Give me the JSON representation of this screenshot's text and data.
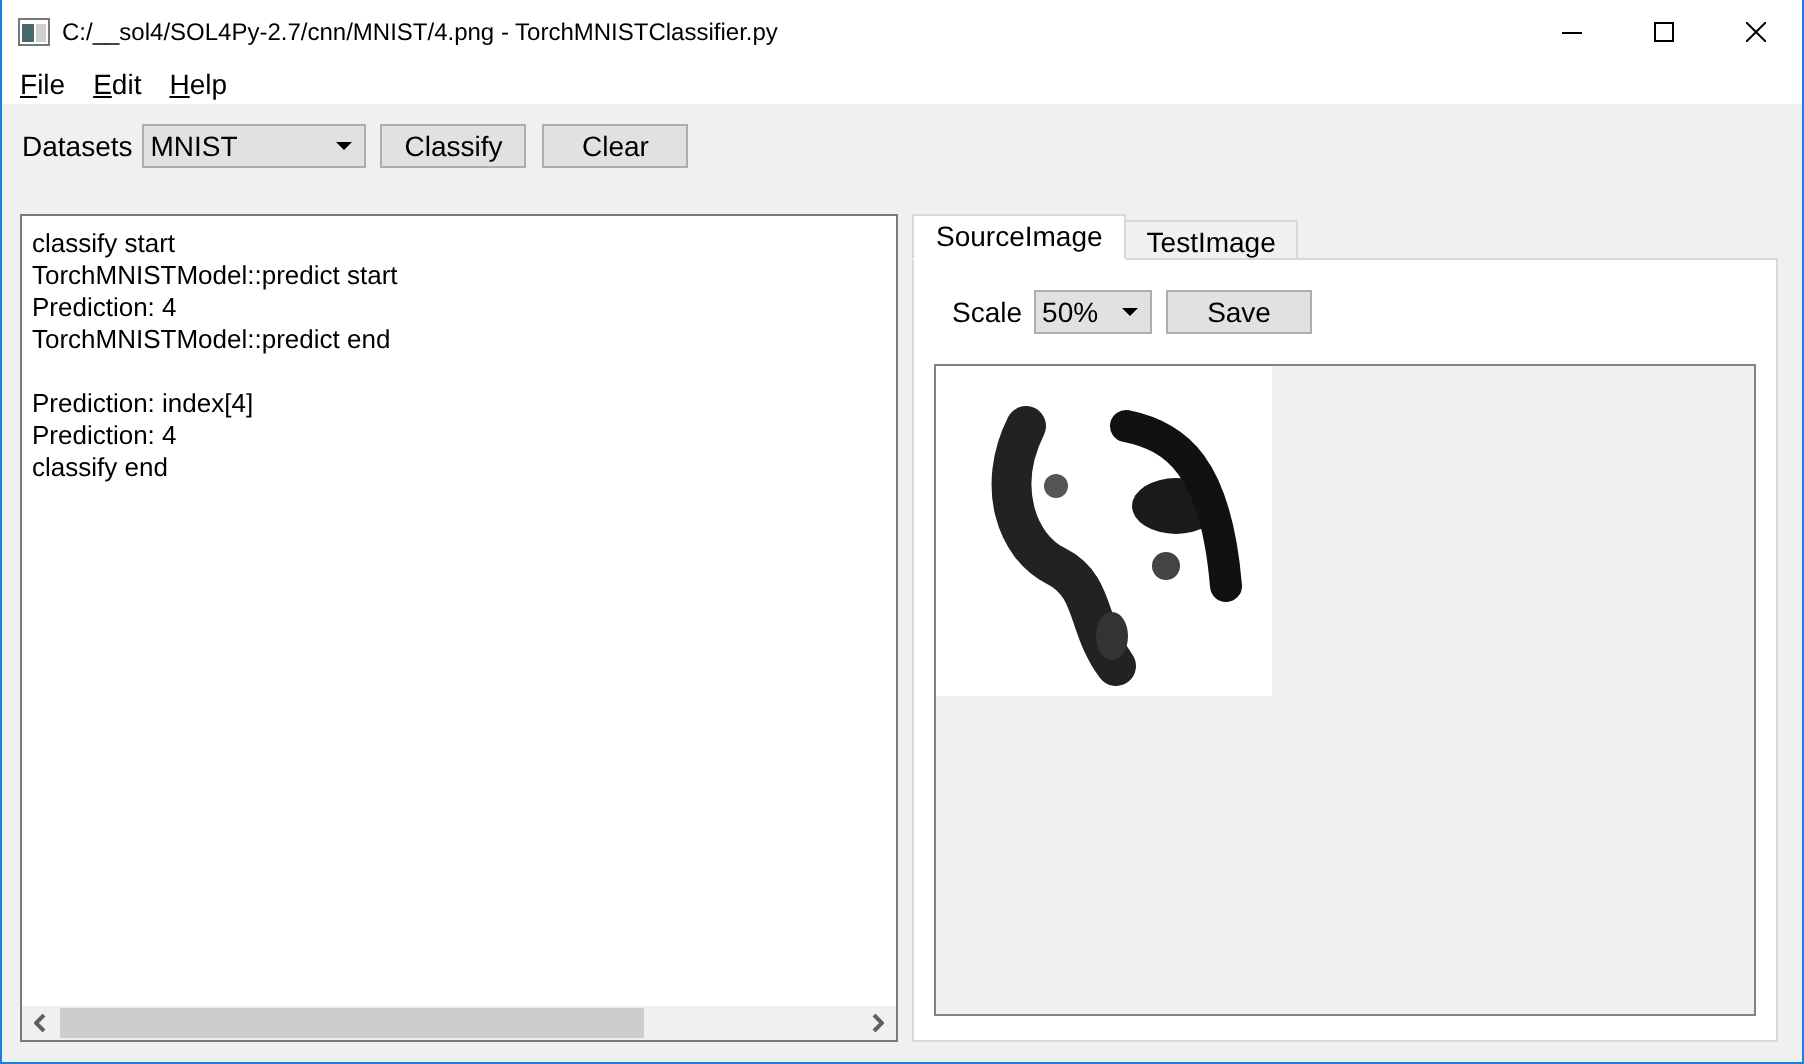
{
  "window": {
    "title": "C:/__sol4/SOL4Py-2.7/cnn/MNIST/4.png - TorchMNISTClassifier.py"
  },
  "menu": [
    "File",
    "Edit",
    "Help"
  ],
  "toolbar": {
    "datasets_label": "Datasets",
    "dataset": "MNIST",
    "buttons": [
      "Classify",
      "Clear"
    ]
  },
  "log_blocks": [
    [
      "classify start",
      "TorchMNISTModel::predict start",
      "Prediction: 4",
      "TorchMNISTModel::predict end"
    ],
    [
      "Prediction: index[4]",
      "Prediction: 4",
      "classify end"
    ]
  ],
  "tabs": [
    {
      "label": "SourceImage",
      "selected": true
    },
    {
      "label": "TestImage",
      "selected": false
    }
  ],
  "image_panel": {
    "scale_label": "Scale",
    "scale": "50%",
    "save_button": "Save"
  }
}
